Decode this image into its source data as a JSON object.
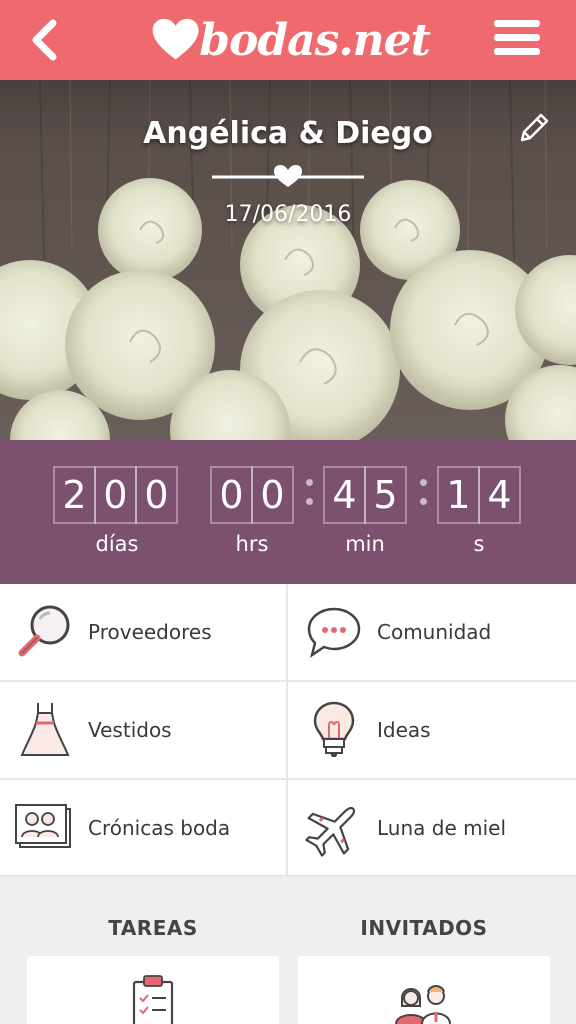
{
  "header": {
    "logo_text": "bodas.net",
    "brand_color": "#ee6a6e"
  },
  "hero": {
    "couple": "Angélica & Diego",
    "date": "17/06/2016"
  },
  "countdown": {
    "color": "#7c5170",
    "days": [
      "2",
      "0",
      "0"
    ],
    "hours": [
      "0",
      "0"
    ],
    "minutes": [
      "4",
      "5"
    ],
    "seconds": [
      "1",
      "4"
    ],
    "labels": {
      "days": "días",
      "hours": "hrs",
      "minutes": "min",
      "seconds": "s"
    }
  },
  "menu": [
    {
      "label": "Proveedores",
      "icon": "magnifier-icon"
    },
    {
      "label": "Comunidad",
      "icon": "chat-bubble-icon"
    },
    {
      "label": "Vestidos",
      "icon": "dress-icon"
    },
    {
      "label": "Ideas",
      "icon": "lightbulb-icon"
    },
    {
      "label": "Crónicas boda",
      "icon": "photo-couple-icon"
    },
    {
      "label": "Luna de miel",
      "icon": "airplane-icon"
    }
  ],
  "sections": {
    "tasks": "TAREAS",
    "guests": "INVITADOS"
  }
}
